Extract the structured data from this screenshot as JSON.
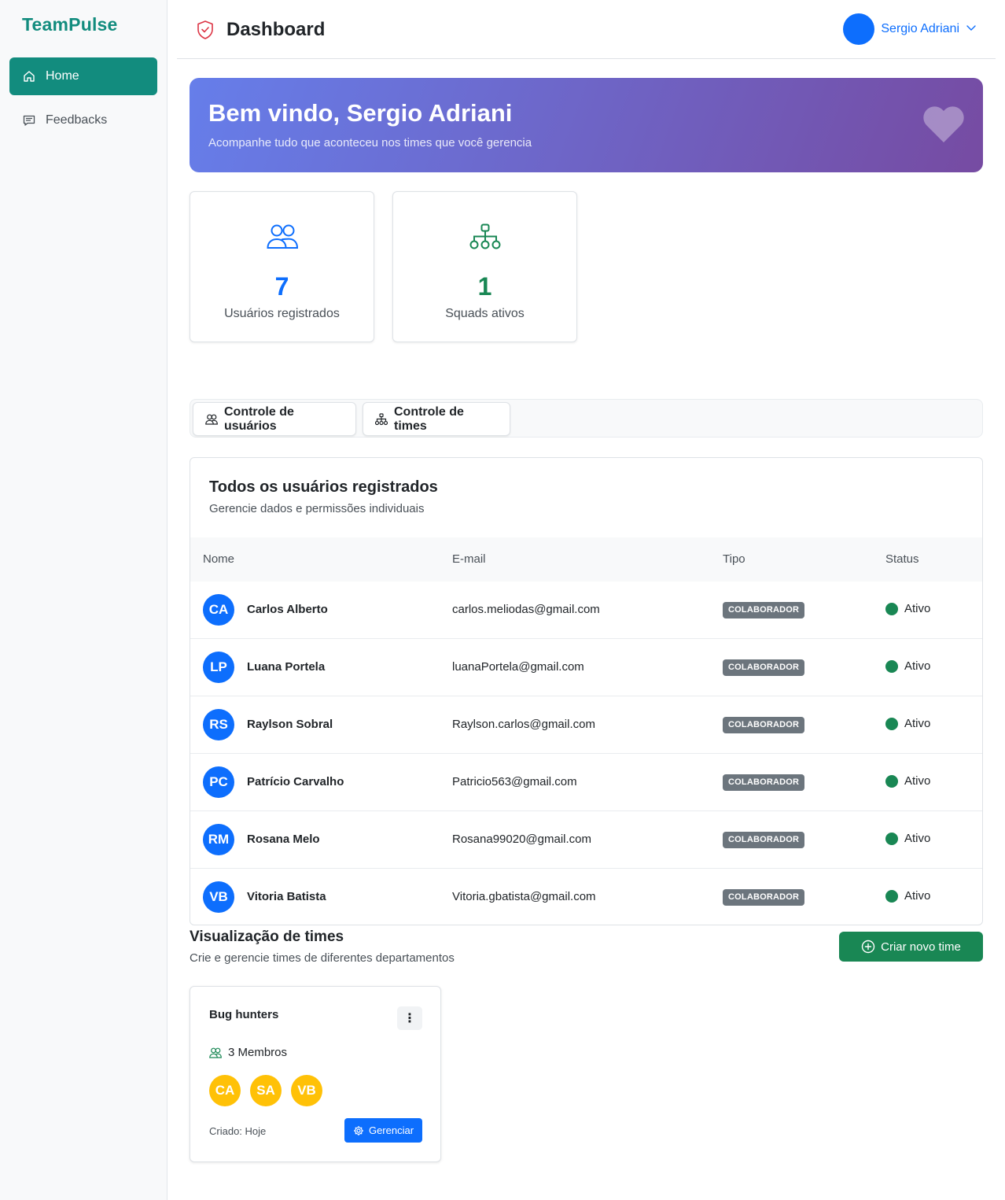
{
  "app": {
    "brand": "TeamPulse"
  },
  "sidebar": {
    "items": [
      {
        "label": "Home",
        "icon": "home-icon",
        "active": true
      },
      {
        "label": "Feedbacks",
        "icon": "message-square-icon",
        "active": false
      }
    ]
  },
  "header": {
    "title": "Dashboard",
    "user_name": "Sergio Adriani"
  },
  "banner": {
    "title": "Bem vindo, Sergio Adriani",
    "subtitle": "Acompanhe tudo que aconteceu nos times que você gerencia"
  },
  "stats": {
    "users": {
      "value": "7",
      "label": "Usuários registrados"
    },
    "squads": {
      "value": "1",
      "label": "Squads ativos"
    }
  },
  "tabs": [
    {
      "label": "Controle de usuários"
    },
    {
      "label": "Controle de times"
    }
  ],
  "users_card": {
    "title": "Todos os usuários registrados",
    "subtitle": "Gerencie dados e permissões individuais",
    "columns": [
      "Nome",
      "E-mail",
      "Tipo",
      "Status"
    ],
    "rows": [
      {
        "initials": "CA",
        "name": "Carlos Alberto",
        "email": "carlos.meliodas@gmail.com",
        "type": "COLABORADOR",
        "status": "Ativo"
      },
      {
        "initials": "LP",
        "name": "Luana Portela",
        "email": "luanaPortela@gmail.com",
        "type": "COLABORADOR",
        "status": "Ativo"
      },
      {
        "initials": "RS",
        "name": "Raylson Sobral",
        "email": "Raylson.carlos@gmail.com",
        "type": "COLABORADOR",
        "status": "Ativo"
      },
      {
        "initials": "PC",
        "name": "Patrício Carvalho",
        "email": "Patricio563@gmail.com",
        "type": "COLABORADOR",
        "status": "Ativo"
      },
      {
        "initials": "RM",
        "name": "Rosana Melo",
        "email": "Rosana99020@gmail.com",
        "type": "COLABORADOR",
        "status": "Ativo"
      },
      {
        "initials": "VB",
        "name": "Vitoria Batista",
        "email": "Vitoria.gbatista@gmail.com",
        "type": "COLABORADOR",
        "status": "Ativo"
      }
    ]
  },
  "teams": {
    "title": "Visualização de times",
    "subtitle": "Crie e gerencie times de diferentes departamentos",
    "create_label": "Criar novo time",
    "cards": [
      {
        "name": "Bug hunters",
        "menu_glyph": "⋮",
        "members_label": "3 Membros",
        "member_initials": [
          "CA",
          "SA",
          "VB"
        ],
        "created": "Criado: Hoje",
        "manage_label": "Gerenciar"
      }
    ]
  },
  "colors": {
    "brand": "#128c7e",
    "primary": "#0d6efd",
    "success": "#198754",
    "badge": "#6c757d",
    "member_avatar": "#ffc107",
    "banner_gradient_start": "#667eea",
    "banner_gradient_end": "#764ba2"
  }
}
